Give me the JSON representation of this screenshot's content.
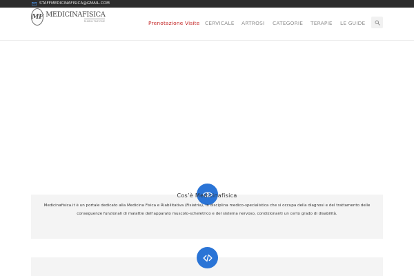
{
  "topbar": {
    "email": "STAFFMEDICINAFISICA@GMAIL.COM",
    "icon": "mail-icon"
  },
  "logo": {
    "mark": "MF",
    "name": "MEDICINAFISICA",
    "subtitle": "RIABILITAZIONE"
  },
  "nav": {
    "items": [
      {
        "label": "Prenotazione Visite"
      },
      {
        "label": "CERVICALE"
      },
      {
        "label": "ARTROSI"
      },
      {
        "label": "CATEGORIE"
      },
      {
        "label": "TERAPIE"
      },
      {
        "label": "LE GUIDE"
      }
    ],
    "search_icon": "search-icon",
    "active_color": "#c21f1f"
  },
  "section1": {
    "icon": "eye-icon",
    "title": "Cos’è Medicinafisica",
    "body": "Medicinafisica.it è un portale dedicato alla Medicina Fisica e Riabilitativa (Fisiatria), la disciplina medico-specialistica che si occupa della diagnosi e del trattamento delle conseguenze funzionali di malattie dell’apparato muscolo-scheletrico e del sistema nervoso, condizionanti un certo grado di disabilità."
  },
  "section2": {
    "icon": "code-icon"
  },
  "colors": {
    "accent": "#2a74d6",
    "topbar": "#2c2c2c",
    "panel": "#f4f4f4"
  }
}
